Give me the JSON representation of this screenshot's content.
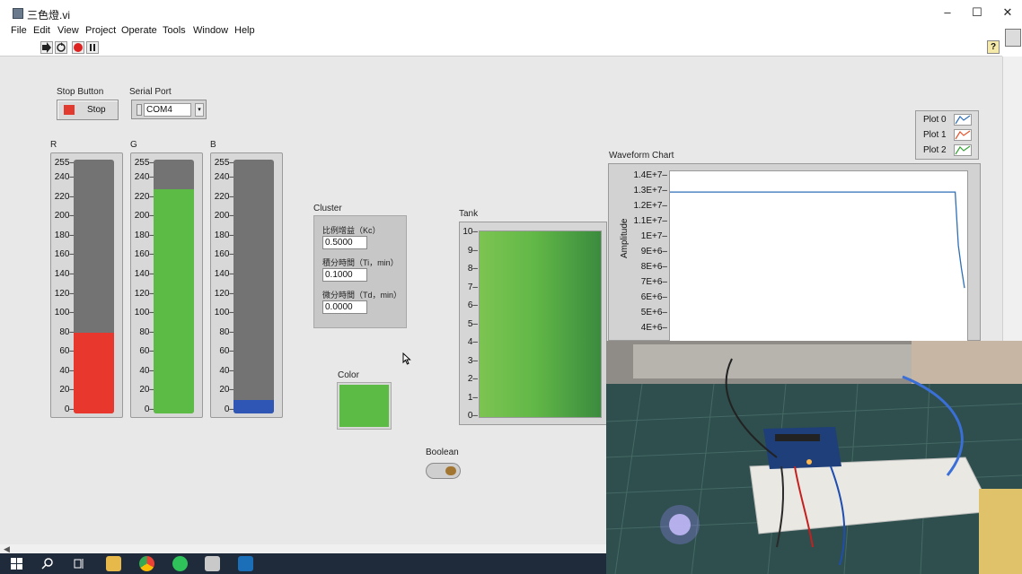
{
  "window": {
    "title": "三色燈.vi",
    "controls": [
      "–",
      "☐",
      "✕"
    ]
  },
  "menu": [
    "File",
    "Edit",
    "View",
    "Project",
    "Operate",
    "Tools",
    "Window",
    "Help"
  ],
  "toolbar": {
    "help_glyph": "?"
  },
  "stop": {
    "caption": "Stop Button",
    "label": "Stop",
    "indicator_color": "#e23a2f"
  },
  "serial": {
    "caption": "Serial Port",
    "value": "COM4",
    "arrow": "▾"
  },
  "sliders": {
    "scale": [
      "255",
      "240",
      "220",
      "200",
      "180",
      "160",
      "140",
      "120",
      "100",
      "80",
      "60",
      "40",
      "20",
      "0"
    ],
    "r": {
      "caption": "R",
      "value": 80,
      "fill_color": "#e8372c"
    },
    "g": {
      "caption": "G",
      "value": 228,
      "fill_color": "#5cbb44"
    },
    "b": {
      "caption": "B",
      "value": 10,
      "fill_color": "#2f56b4"
    }
  },
  "cluster": {
    "caption": "Cluster",
    "fields": [
      {
        "label": "比例增益（Kc）",
        "value": "0.5000"
      },
      {
        "label": "積分時間（Ti，min）",
        "value": "0.1000"
      },
      {
        "label": "微分時間（Td，min）",
        "value": "0.0000"
      }
    ]
  },
  "color": {
    "caption": "Color",
    "value": "#5cbb44"
  },
  "tank": {
    "caption": "Tank",
    "scale": [
      "10",
      "9",
      "8",
      "7",
      "6",
      "5",
      "4",
      "3",
      "2",
      "1",
      "0"
    ],
    "level": 10
  },
  "boolean": {
    "caption": "Boolean",
    "state": "off"
  },
  "chart_data": {
    "type": "line",
    "title": "Waveform Chart",
    "xlabel": "",
    "ylabel": "Amplitude",
    "ytick_labels": [
      "1.4E+7",
      "1.3E+7",
      "1.2E+7",
      "1.1E+7",
      "1E+7",
      "9E+6",
      "8E+6",
      "7E+6",
      "6E+6",
      "5E+6",
      "4E+6"
    ],
    "y_range_visible": [
      4000000,
      14000000
    ],
    "series": [
      {
        "values": [
          13000000,
          13000000,
          13000000,
          13000000,
          13000000,
          13000000,
          13000000,
          13000000,
          13000000,
          13000000,
          13000000,
          13000000,
          13000000,
          13000000,
          13000000,
          13000000,
          13000000,
          13000000,
          13000000,
          13000000,
          13000000,
          13000000,
          13000000,
          13000000,
          13000000,
          13000000,
          13000000,
          13000000,
          13000000,
          13000000,
          13000000,
          13000000,
          13000000,
          13000000,
          13000000,
          13000000,
          13000000,
          13000000,
          13000000,
          13000000,
          13000000,
          13000000,
          13000000,
          13000000,
          13000000,
          13000000,
          13000000,
          13000000,
          13000000,
          13000000,
          13000000,
          13000000,
          13000000,
          13000000,
          13000000,
          13000000,
          13000000,
          13000000,
          13000000,
          13000000,
          13000000,
          13000000,
          13000000,
          13000000,
          13000000,
          13000000,
          13000000,
          13000000,
          13000000,
          13000000,
          13000000,
          13000000,
          13000000,
          13000000,
          13000000,
          13000000,
          13000000,
          13000000,
          13000000,
          13000000,
          13000000,
          13000000,
          13000000,
          13000000,
          13000000,
          13000000,
          13000000,
          13000000,
          13000000,
          13000000,
          13000000,
          13000000,
          13000000,
          9500000,
          8000000,
          6700000
        ]
      }
    ],
    "legend": [
      {
        "name": "Plot 0",
        "color": "#2f6fb5"
      },
      {
        "name": "Plot 1",
        "color": "#e3562e"
      },
      {
        "name": "Plot 2",
        "color": "#3aa23a"
      }
    ],
    "line_color": "#2f6fb5",
    "legend_position": "top-right"
  }
}
